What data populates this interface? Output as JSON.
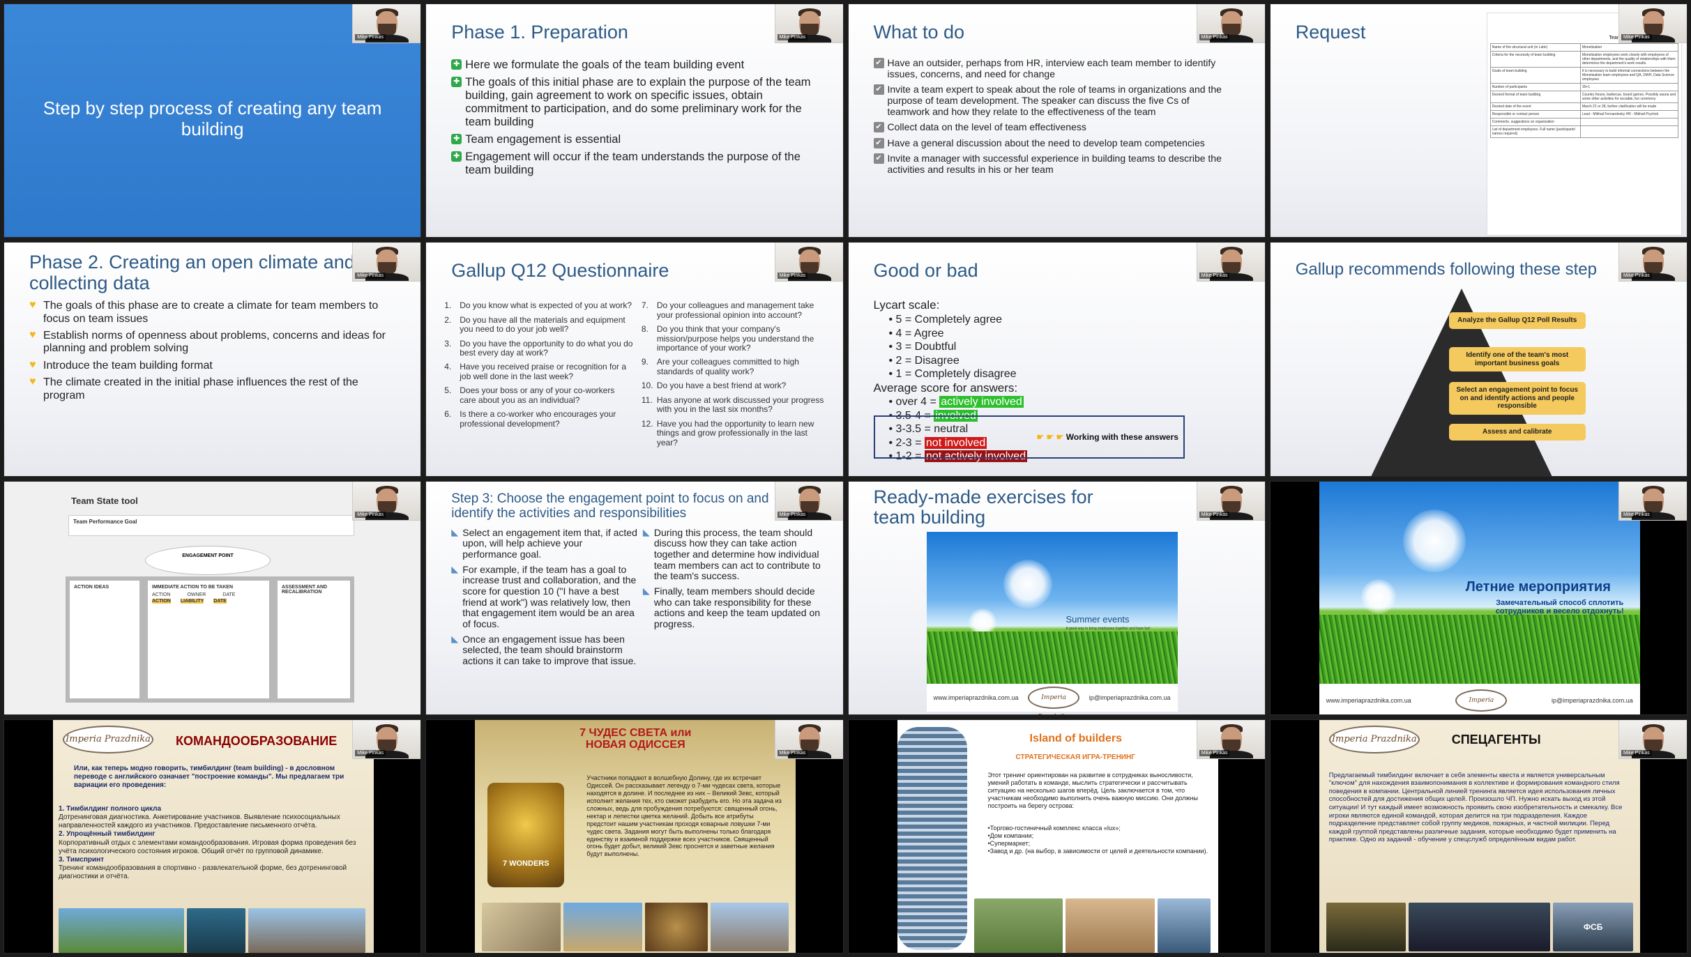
{
  "presenter": {
    "name": "Mike Pinkas"
  },
  "slides": {
    "s1": {
      "title": "Step by step process of creating any team building"
    },
    "s2": {
      "title": "Phase 1. Preparation",
      "bullets": [
        "Here we formulate the goals of the team building event",
        "The goals of this initial phase are to explain the purpose of the team building, gain agreement to work on specific issues, obtain commitment to participation, and do some preliminary work for the team building",
        "Team engagement is essential",
        "Engagement will occur if the team understands the purpose of the team building"
      ]
    },
    "s3": {
      "title": "What to do",
      "bullets": [
        "Have an outsider, perhaps from HR, interview each team member to identify issues, concerns, and need for change",
        "Invite a team expert to speak about the role of teams in organizations and the purpose of team development. The speaker can discuss the five Cs of teamwork and how they relate to the effectiveness of the team",
        "Collect data on the level of team effectiveness",
        "Have a general discussion about the need to develop team competencies",
        "Invite a manager with successful experience in building teams to describe the activities and results in his or her team"
      ]
    },
    "s4": {
      "title": "Request",
      "form_title": "Teambuilding Application Form",
      "rows": [
        {
          "k": "Name of the structural unit (in Latin)",
          "v": "Monetization"
        },
        {
          "k": "Criteria for the necessity of team building",
          "v": "Monetization employees work closely with employees of other departments, and the quality of relationships with them determines the department's work results."
        },
        {
          "k": "Goals of team building",
          "v": "It is necessary to build informal connections between the Monetization team employees and QA, DWH, Data Science employees"
        },
        {
          "k": "Number of participants",
          "v": "30+1"
        },
        {
          "k": "Desired format of team building",
          "v": "Country house, barbecue, board games. Possibly sauna and some other activities for sociable, fun ceremony"
        },
        {
          "k": "Desired date of the event",
          "v": "March 21 or 28, further clarification will be made"
        },
        {
          "k": "Responsible or contact person",
          "v": "Lead - Mikhail Fernandesky HR - Mikhail Prychek"
        },
        {
          "k": "Comments, suggestions on organization",
          "v": ""
        },
        {
          "k": "List of department employees. Full name (participants' names required)",
          "v": ""
        }
      ]
    },
    "s5": {
      "title": "Phase 2. Creating an open climate and collecting data",
      "bullets": [
        "The goals of this phase are to create a climate for team members to focus on team issues",
        "Establish norms of openness about problems, concerns and ideas for planning and problem solving",
        "Introduce the team building format",
        "The climate created in the initial phase influences the rest of the program"
      ]
    },
    "s6": {
      "title": "Gallup Q12 Questionnaire",
      "left": [
        {
          "n": "1.",
          "q": "Do you know what is expected of you at work?"
        },
        {
          "n": "2.",
          "q": "Do you have all the materials and equipment you need to do your job well?"
        },
        {
          "n": "3.",
          "q": "Do you have the opportunity to do what you do best every day at work?"
        },
        {
          "n": "4.",
          "q": "Have you received praise or recognition for a job well done in the last week?"
        },
        {
          "n": "5.",
          "q": "Does your boss or any of your co-workers care about you as an individual?"
        },
        {
          "n": "6.",
          "q": "Is there a co-worker who encourages your professional development?"
        }
      ],
      "right": [
        {
          "n": "7.",
          "q": "Do your colleagues and management take your professional opinion into account?"
        },
        {
          "n": "8.",
          "q": "Do you think that your company's mission/purpose helps you understand the importance of your work?"
        },
        {
          "n": "9.",
          "q": "Are your colleagues committed to high standards of quality work?"
        },
        {
          "n": "10.",
          "q": "Do you have a best friend at work?"
        },
        {
          "n": "11.",
          "q": "Has anyone at work discussed your progress with you in the last six months?"
        },
        {
          "n": "12.",
          "q": "Have you had the opportunity to learn new things and grow professionally in the last year?"
        }
      ]
    },
    "s7": {
      "title": "Good or bad",
      "scale_head": "Lycart scale:",
      "scale": [
        "5 = Completely agree",
        "4 = Agree",
        "3 = Doubtful",
        "2 = Disagree",
        "1 = Completely disagree"
      ],
      "avg_head": "Average score for answers:",
      "avg": [
        {
          "range": "over 4 = ",
          "label": "actively involved"
        },
        {
          "range": "3.5-4 = ",
          "label": "involved"
        },
        {
          "range": "3-3.5 = ",
          "label": "neutral"
        },
        {
          "range": "2-3 = ",
          "label": "not involved"
        },
        {
          "range": "1-2 = ",
          "label": "not actively involved"
        }
      ],
      "work_note": "Working with these answers"
    },
    "s8": {
      "title": "Gallup recommends following these step",
      "steps": [
        "Analyze the Gallup Q12 Poll Results",
        "Identify one of the team's most important business goals",
        "Select an engagement point to focus on and identify actions and people responsible",
        "Assess and calibrate"
      ]
    },
    "s9": {
      "title": "Team State tool",
      "goal": "Team Performance Goal",
      "roof": "ENGAGEMENT POINT",
      "col1": "ACTION IDEAS",
      "col2": "IMMEDIATE ACTION TO BE TAKEN",
      "col2a": "ACTION",
      "col2b": "OWNER",
      "col2c": "DATE",
      "col3": "ASSESSMENT AND RECALIBRATION",
      "tags": [
        "ACTION",
        "LIABILITY",
        "DATE"
      ]
    },
    "s10": {
      "title": "Step 3: Choose the engagement point to focus on and identify the activities and responsibilities",
      "left": [
        "Select an engagement item that, if acted upon, will help achieve your performance goal.",
        "For example, if the team has a goal to increase trust and collaboration, and the score for question 10 (\"I have a best friend at work\") was relatively low, then that engagement item would be an area of focus.",
        "Once an engagement issue has been selected, the team should brainstorm actions it can take to improve that issue."
      ],
      "right": [
        "During this process, the team should discuss how they can take action together and determine how individual team members can act to contribute to the team's success.",
        "Finally, team members should decide who can take responsibility for these actions and keep the team updated on progress."
      ]
    },
    "s11": {
      "title": "Ready-made exercises for team building",
      "photo_title": "Summer events",
      "photo_sub": "A great way to bring employees together and have fun!",
      "site": "www.imperiaprazdnika.com.ua",
      "email": "ip@imperiaprazdnika.com.ua",
      "logo": "Imperia Prazdnika"
    },
    "s12": {
      "title": "Летние мероприятия",
      "sub": "Замечательный способ сплотить сотрудников и весело отдохнуть!",
      "site": "www.imperiaprazdnika.com.ua",
      "email": "ip@imperiaprazdnika.com.ua",
      "logo": "Imperia Prazdnika"
    },
    "s13": {
      "logo": "Imperia Prazdnika",
      "title": "КОМАНДООБРАЗОВАНИЕ",
      "intro": "Или, как теперь модно говорить, тимбилдинг (team building) - в дословном переводе с английского означает \"построение команды\". Мы предлагаем три вариации его проведения:",
      "items": [
        {
          "h": "1. Тимбилдинг полного цикла",
          "t": "Дотренинговая диагностика. Анкетирование участников. Выявление психосоциальных направленностей каждого из участников. Предоставление письменного отчёта."
        },
        {
          "h": "2. Упрощённый тимбилдинг",
          "t": "Корпоративный отдых с элементами командообразования. Игровая форма проведения без учёта психологического состояния игроков. Общий отчёт по групповой динамике."
        },
        {
          "h": "3. Тимспринт",
          "t": "Тренинг командообразования в спортивно - развлекательной форме, без дотренинговой диагностики и отчёта."
        }
      ]
    },
    "s14": {
      "title": "7 ЧУДЕС СВЕТА или НОВАЯ ОДИССЕЯ",
      "badge": "7 WONDERS",
      "text": "Участники попадают в волшебную Долину, где их встречает Одиссей. Он рассказывает легенду о 7-ми чудесах света, которые находятся в долине. И последнее из них – Великий Зевс, который исполнит желания тех, кто сможет разбудить его. Но эта задача из сложных, ведь для пробуждения потребуются: священный огонь, нектар и лепестки цветка желаний. Добыть все атрибуты предстоит нашим участникам проходя коварные ловушки 7-ми чудес света. Задания могут быть выполнены только благодаря единству и взаимной поддержке всех участников. Священный огонь будет добыт, великий Зевс проснется и заветные желания будут выполнены."
    },
    "s15": {
      "title": "Island of builders",
      "sub": "СТРАТЕГИЧЕСКАЯ ИГРА-ТРЕНИНГ",
      "text": "Этот тренинг ориентирован на развитие в сотрудниках выносливости, умений работать в команде, мыслить стратегически и рассчитывать ситуацию на несколько шагов вперёд. Цель заключается в том, что участникам необходимо выполнить очень важную миссию. Они должны построить на берегу острова:",
      "list": [
        "•Торгово-гостиничный комплекс класса «lux»;",
        "•Дом компании;",
        "•Супермаркет;",
        "•Завод и др. (на выбор, в зависимости от целей и деятельности компании)."
      ]
    },
    "s16": {
      "logo": "Imperia Prazdnika",
      "title": "СПЕЦАГЕНТЫ",
      "text": "Предлагаемый тимбилдинг включает в себя элементы квеста и является универсальным \"ключом\" для нахождения взаимопонимания в коллективе и формирования командного стиля поведения в компании. Центральной линией тренинга является идея использования личных способностей для достижения общих целей. Произошло ЧП. Нужно искать выход из этой ситуации! И тут каждый имеет возможность проявить свою изобретательность и смекалку. Все игроки являются единой командой, которая делится на три подразделения. Каждое подразделение представляет собой группу медиков, пожарных, и частной милиции. Перед каждой группой представлены различные задания, которые необходимо будет применить на практике. Одно из заданий - обучение у спецслужб определённым видам работ.",
      "badge": "ФСБ"
    }
  },
  "colors": {
    "accent": "#2d5a86",
    "slide_blue": "#3b87d8",
    "green": "#2dbf2d",
    "red": "#d11818",
    "gold": "#f4c95d"
  }
}
